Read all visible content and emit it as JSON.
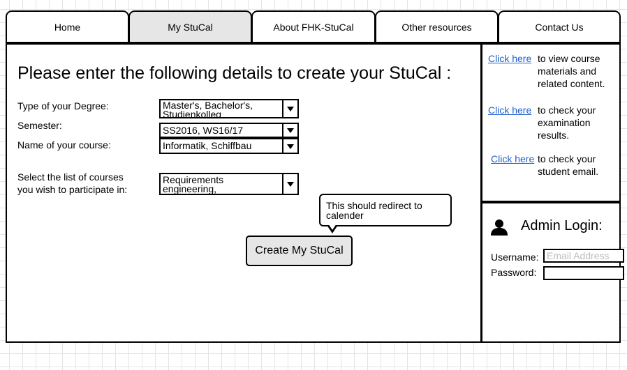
{
  "nav": {
    "tabs": [
      {
        "label": "Home"
      },
      {
        "label": "My StuCal",
        "active": true
      },
      {
        "label": "About FHK-StuCal"
      },
      {
        "label": "Other resources"
      },
      {
        "label": "Contact Us"
      }
    ]
  },
  "form": {
    "title": "Please enter the following details to create your StuCal :",
    "degree": {
      "label": "Type of your Degree:",
      "value_line1": "Master's, Bachelor's,",
      "value_line2": "Studienkolleg"
    },
    "semester": {
      "label": "Semester:",
      "value": "SS2016, WS16/17"
    },
    "course": {
      "label": "Name of your course:",
      "value": "Informatik, Schiffbau"
    },
    "course_list": {
      "label_line1": "Select the list of courses",
      "label_line2": "you wish to participate in:",
      "value_line1": "Requirements",
      "value_line2": "engineering,"
    },
    "tooltip_line1": "This should redirect to",
    "tooltip_line2": "calender",
    "submit_label": "Create My StuCal"
  },
  "links": [
    {
      "link_text": "Click here",
      "desc_line1": "to view course",
      "desc_line2": "materials and",
      "desc_line3": "related content."
    },
    {
      "link_text": "Click here",
      "desc_line1": "to check your",
      "desc_line2": "examination",
      "desc_line3": "results."
    },
    {
      "link_text": "Click here",
      "desc_line1": "to check your",
      "desc_line2": "student email."
    }
  ],
  "admin": {
    "title": "Admin Login:",
    "username_label": "Username:",
    "username_placeholder": "Email Address",
    "password_label": "Password:",
    "icon": "user-icon"
  }
}
